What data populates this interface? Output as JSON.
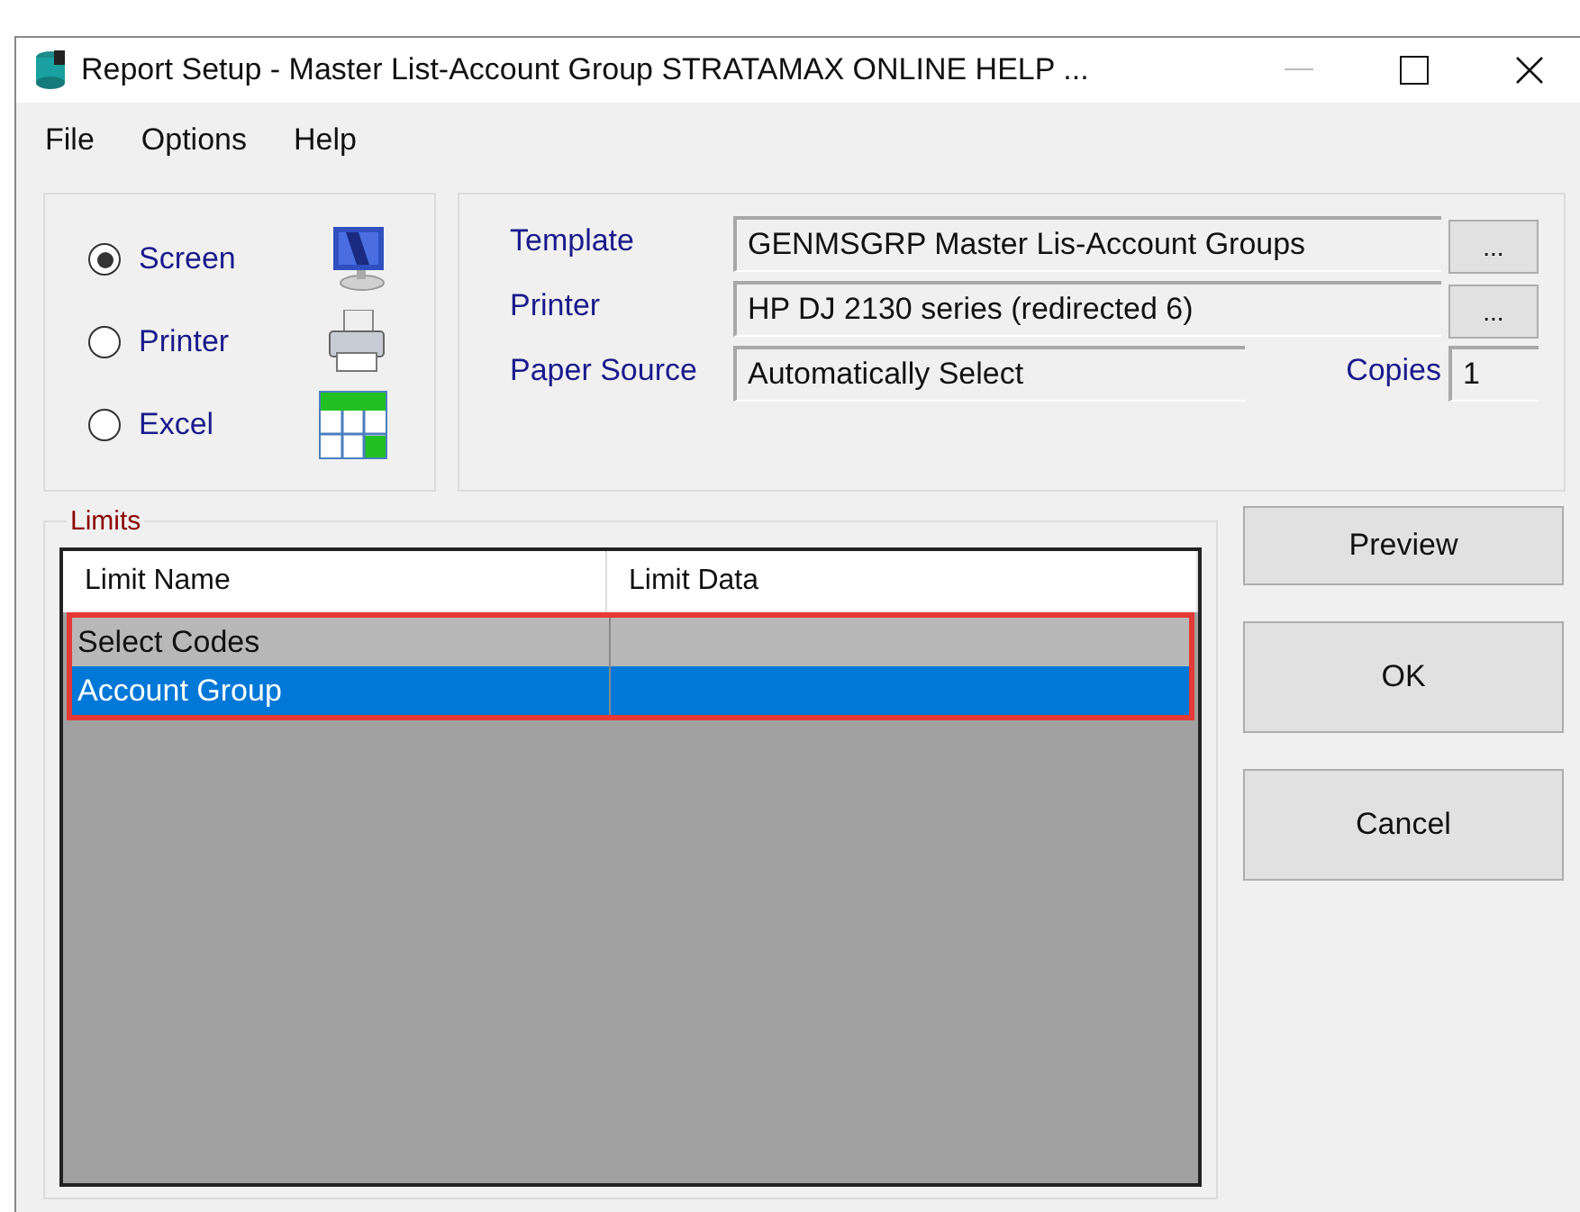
{
  "window": {
    "title": "Report Setup - Master List-Account Group STRATAMAX ONLINE HELP ..."
  },
  "menu": [
    "File",
    "Options",
    "Help"
  ],
  "output": [
    {
      "label": "Screen",
      "selected": true,
      "kind": "screen"
    },
    {
      "label": "Printer",
      "selected": false,
      "kind": "printer"
    },
    {
      "label": "Excel",
      "selected": false,
      "kind": "excel"
    }
  ],
  "settings": {
    "template": {
      "label": "Template",
      "value": "GENMSGRP Master Lis-Account Groups",
      "button": "..."
    },
    "printer": {
      "label": "Printer",
      "value": "HP DJ 2130 series (redirected 6)",
      "button": "..."
    },
    "paper_source": {
      "label": "Paper Source",
      "value": "Automatically Select"
    },
    "copies": {
      "label": "Copies",
      "value": "1"
    }
  },
  "limits": {
    "title": "Limits",
    "columns": [
      "Limit Name",
      "Limit Data"
    ],
    "outlined": true,
    "rows": [
      {
        "name": "Select Codes",
        "selected": false
      },
      {
        "name": "Account Group",
        "selected": true
      }
    ]
  },
  "buttons": [
    "Preview",
    "OK",
    "Cancel"
  ]
}
